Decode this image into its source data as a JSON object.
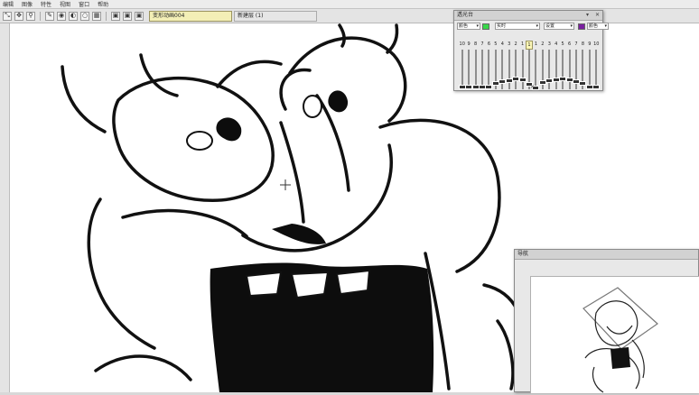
{
  "menubar": {
    "items": [
      "编辑",
      "图像",
      "特性",
      "视图",
      "窗口",
      "帮助"
    ]
  },
  "toolbar": {
    "tools": [
      {
        "name": "transform-icon",
        "glyph": "⤡"
      },
      {
        "name": "grab-icon",
        "glyph": "✥"
      },
      {
        "name": "zoom-icon",
        "glyph": "⚲"
      },
      {
        "name": "pen-icon",
        "glyph": "✎"
      },
      {
        "name": "color-wheel-icon",
        "glyph": "◉"
      },
      {
        "name": "contrast-icon",
        "glyph": "◐"
      },
      {
        "name": "bulb-icon",
        "glyph": "○"
      },
      {
        "name": "grid-icon",
        "glyph": "▦"
      },
      {
        "name": "window-icon",
        "glyph": "▣"
      },
      {
        "name": "window-icon",
        "glyph": "▣"
      },
      {
        "name": "window-icon",
        "glyph": "▣"
      }
    ]
  },
  "tabs": [
    {
      "label": "变形动画004",
      "active": true
    },
    {
      "label": "新建层 (1)",
      "active": false
    }
  ],
  "light_table": {
    "title": "透光台",
    "close_glyph": "✕",
    "collapse_glyph": "▾",
    "color_left": "#39d84a",
    "color_right": "#7a1fa0",
    "left_label": "颜色",
    "mode_value": "实时",
    "settings_value": "设置",
    "right_label": "颜色",
    "frames_before": [
      "10",
      "9",
      "8",
      "7",
      "6",
      "5",
      "4",
      "3",
      "2",
      "1"
    ],
    "current_frame": "1",
    "frames_after": [
      "1",
      "2",
      "3",
      "4",
      "5",
      "6",
      "7",
      "8",
      "9",
      "10"
    ],
    "slider_levels": [
      0.03,
      0.03,
      0.03,
      0.03,
      0.03,
      0.12,
      0.18,
      0.2,
      0.25,
      0.22,
      0.1,
      0.0,
      0.15,
      0.2,
      0.22,
      0.25,
      0.22,
      0.18,
      0.12,
      0.03,
      0.03
    ],
    "footer": "✕"
  },
  "navigator": {
    "title": "导航"
  }
}
